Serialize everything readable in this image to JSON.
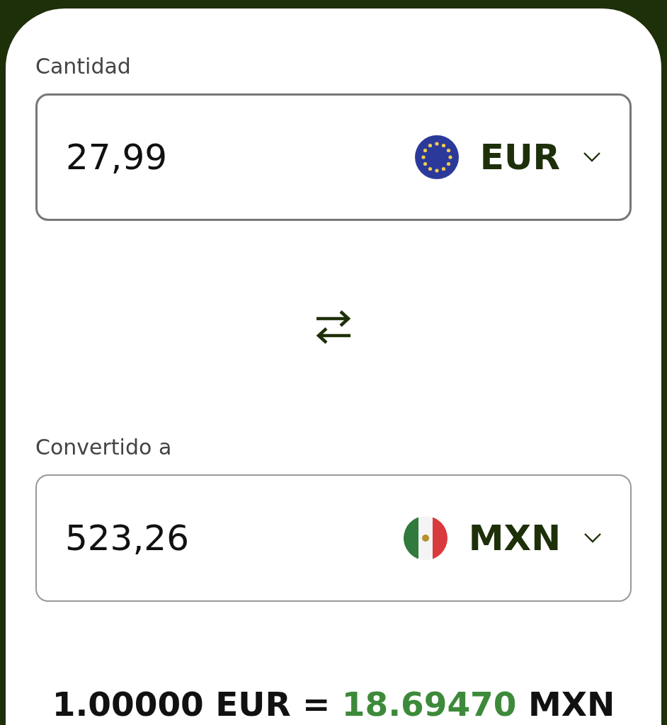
{
  "converter": [
    {
      "label": "Cantidad",
      "amount": "27,99",
      "currency": "EUR",
      "kind": "eu",
      "focused": true
    },
    {
      "label": "Convertido a",
      "amount": "523,26",
      "currency": "MXN",
      "kind": "mx",
      "focused": false
    }
  ],
  "rate": {
    "base": "1.00000 EUR =",
    "value": "18.69470",
    "quote": "MXN"
  }
}
